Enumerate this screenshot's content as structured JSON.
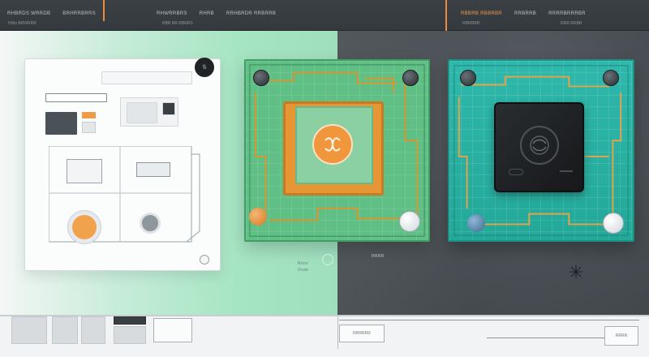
{
  "topbar": {
    "menu_left": [
      "RHBRDS WRRDB",
      "BRHRRBRRS"
    ],
    "sub_left": "HWo BRWRRR",
    "menu_center": [
      "RHWRRBRS",
      "RHRB",
      "RRHBRDR RRBRRB"
    ],
    "sub_center": "RBB RR  RBRRS",
    "menu_right": [
      "RBBRB RBBRBR",
      "RRBRRB",
      "RRRRBRRRBR"
    ],
    "sub_right": [
      "RBRRRB",
      "RRR RRBR"
    ]
  },
  "doc_card": {
    "logo_text": "\\\\",
    "fields": [],
    "icons": [
      "image-icon",
      "document-icon",
      "device-icon",
      "printer-icon"
    ]
  },
  "boards": [
    {
      "name": "green-board",
      "color": "#5fbf85",
      "chip_color": "#e79636"
    },
    {
      "name": "teal-board",
      "color": "#2eb8ab",
      "chip_color": "#1f2326"
    }
  ],
  "labels": {
    "board_caption_1": "Rnnv",
    "board_caption_2": "Ovab",
    "mid_tick": "RRRR"
  },
  "bottombar": {
    "btn_center_label": "RRRRRR",
    "btn_right_label": "RRRR"
  },
  "colors": {
    "accent_orange": "#f08a3a",
    "mint": "#a6e5c3",
    "teal": "#2eb8ab",
    "dark_gray": "#4a5055"
  }
}
